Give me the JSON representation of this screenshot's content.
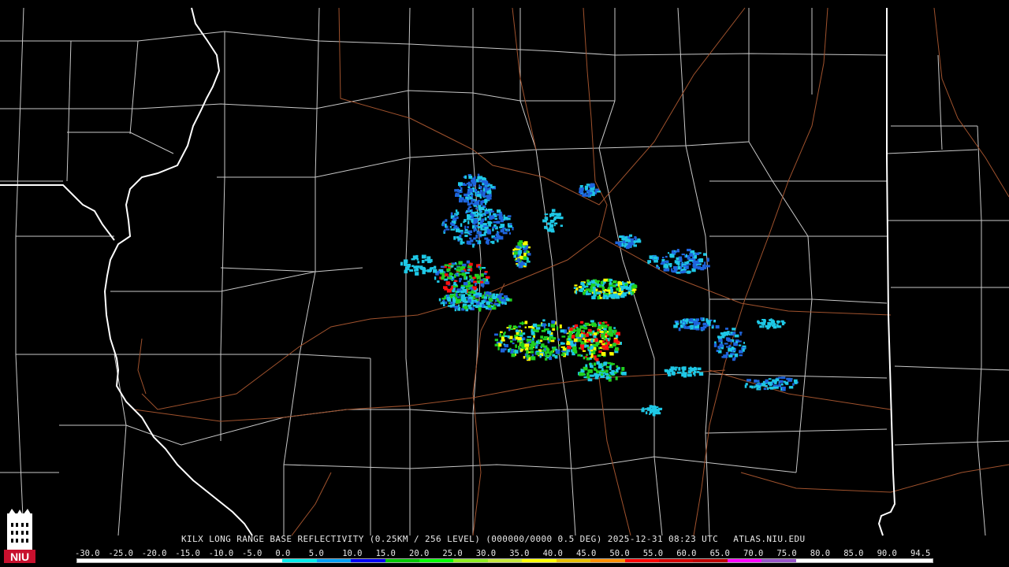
{
  "caption": {
    "product": "KILX LONG RANGE BASE REFLECTIVITY (0.25KM / 256 LEVEL) (000000/0000 0.5 DEG) 2025-12-31 08:23 UTC",
    "site": "ATLAS.NIU.EDU"
  },
  "logo": {
    "label": "NIU",
    "icon": "niu-tower-logo"
  },
  "scale": {
    "labels": [
      "-30.0",
      "-25.0",
      "-20.0",
      "-15.0",
      "-10.0",
      "-5.0",
      "0.0",
      "5.0",
      "10.0",
      "15.0",
      "20.0",
      "25.0",
      "30.0",
      "35.0",
      "40.0",
      "45.0",
      "50.0",
      "55.0",
      "60.0",
      "65.0",
      "70.0",
      "75.0",
      "80.0",
      "85.0",
      "90.0",
      "94.5"
    ],
    "colors": [
      "#ffffff",
      "#ffffff",
      "#ffffff",
      "#ffffff",
      "#ffffff",
      "#ffffff",
      "#00ecec",
      "#01a0f6",
      "#0000f6",
      "#00c800",
      "#00ff00",
      "#90ee20",
      "#c8e83c",
      "#ffff00",
      "#e7c000",
      "#ff9000",
      "#ff0000",
      "#d60000",
      "#c00000",
      "#ff00ff",
      "#9955c9",
      "#ffffff",
      "#ffffff",
      "#ffffff",
      "#ffffff"
    ]
  },
  "map_colors": {
    "county": "#c8c8c8",
    "state": "#ffffff",
    "road": "#a0522d",
    "echo_light": "#1ec8e6",
    "echo_medium": "#1e64dc",
    "echo_green": "#20d020",
    "echo_yellow": "#ffff00",
    "echo_red": "#ff1010"
  }
}
